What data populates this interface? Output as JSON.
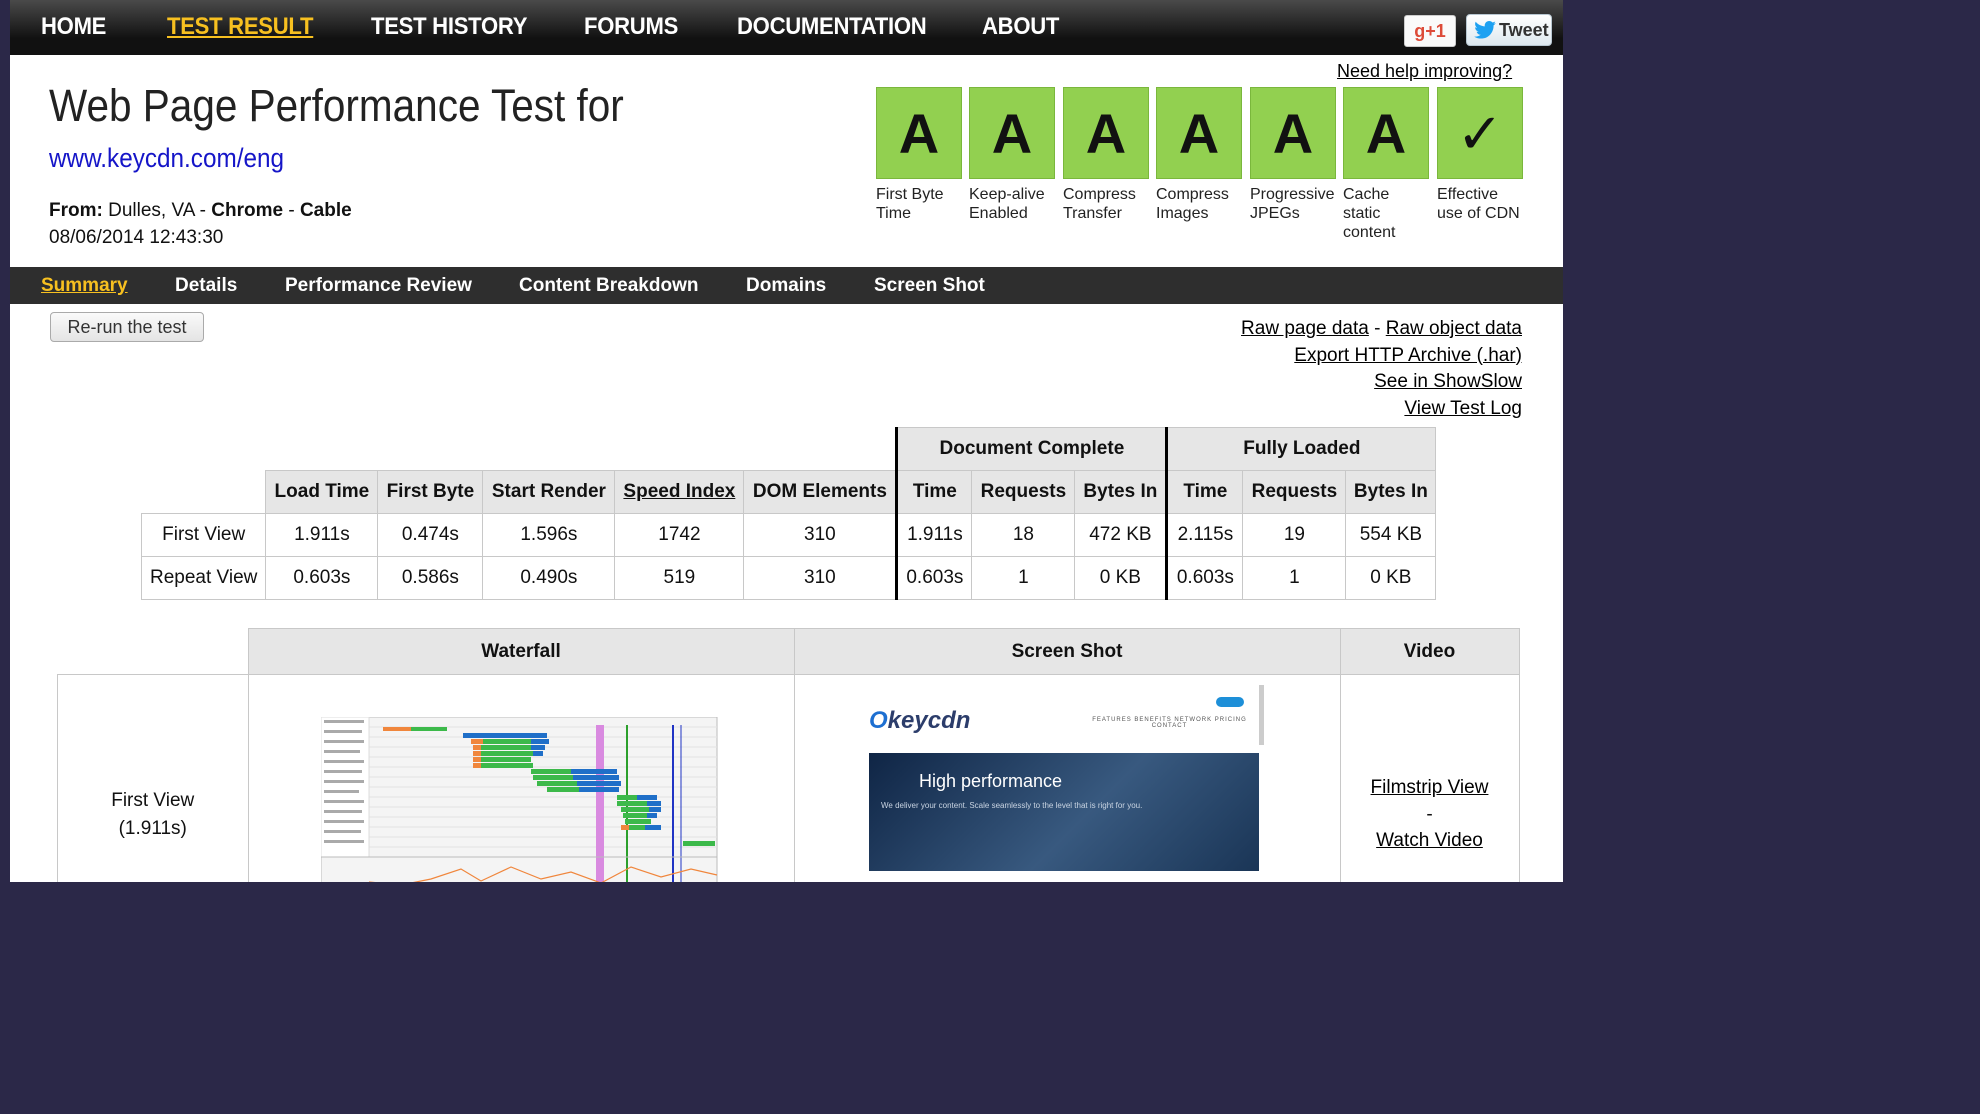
{
  "topnav": {
    "items": [
      "HOME",
      "TEST RESULT",
      "TEST HISTORY",
      "FORUMS",
      "DOCUMENTATION",
      "ABOUT"
    ],
    "gplus_label": "g+1",
    "tweet_label": "Tweet"
  },
  "help_link": "Need help improving?",
  "header": {
    "title": "Web Page Performance Test for",
    "url": "www.keycdn.com/eng",
    "from_label": "From:",
    "from_value": "Dulles, VA - ",
    "browser": "Chrome",
    "sep": " - ",
    "connection": "Cable",
    "date": "08/06/2014 12:43:30"
  },
  "grades": [
    {
      "grade": "A",
      "label": "First Byte Time"
    },
    {
      "grade": "A",
      "label": "Keep-alive Enabled"
    },
    {
      "grade": "A",
      "label": "Compress Transfer"
    },
    {
      "grade": "A",
      "label": "Compress Images"
    },
    {
      "grade": "A",
      "label": "Progressive JPEGs"
    },
    {
      "grade": "A",
      "label": "Cache static content"
    },
    {
      "grade": "✓",
      "label": "Effective use of CDN"
    }
  ],
  "subnav": {
    "items": [
      "Summary",
      "Details",
      "Performance Review",
      "Content Breakdown",
      "Domains",
      "Screen Shot"
    ]
  },
  "rerun_label": "Re-run the test",
  "links": {
    "raw_page": "Raw page data",
    "dash": " - ",
    "raw_object": "Raw object data",
    "export_har": "Export HTTP Archive (.har)",
    "showslow": "See in ShowSlow",
    "test_log": "View Test Log"
  },
  "results": {
    "group_headers": [
      "Document Complete",
      "Fully Loaded"
    ],
    "columns": [
      "Load Time",
      "First Byte",
      "Start Render",
      "Speed Index",
      "DOM Elements",
      "Time",
      "Requests",
      "Bytes In",
      "Time",
      "Requests",
      "Bytes In"
    ],
    "rows": [
      {
        "label": "First View",
        "cells": [
          "1.911s",
          "0.474s",
          "1.596s",
          "1742",
          "310",
          "1.911s",
          "18",
          "472 KB",
          "2.115s",
          "19",
          "554 KB"
        ]
      },
      {
        "label": "Repeat View",
        "cells": [
          "0.603s",
          "0.586s",
          "0.490s",
          "519",
          "310",
          "0.603s",
          "1",
          "0 KB",
          "0.603s",
          "1",
          "0 KB"
        ]
      }
    ]
  },
  "media": {
    "headers": [
      "Waterfall",
      "Screen Shot",
      "Video"
    ],
    "first_view_label": "First View",
    "first_view_time": "(1.911s)",
    "filmstrip": "Filmstrip View",
    "video_sep": "-",
    "watch_video": "Watch Video",
    "screenshot": {
      "logo_k": "O",
      "logo": "keycdn",
      "hero_title": "High performance",
      "hero_text": "We deliver your content. Scale seamlessly to the level that is right for you."
    }
  },
  "colors": {
    "grade_green": "#92d050",
    "active_nav": "#f7c020",
    "url_blue": "#1515c8"
  }
}
